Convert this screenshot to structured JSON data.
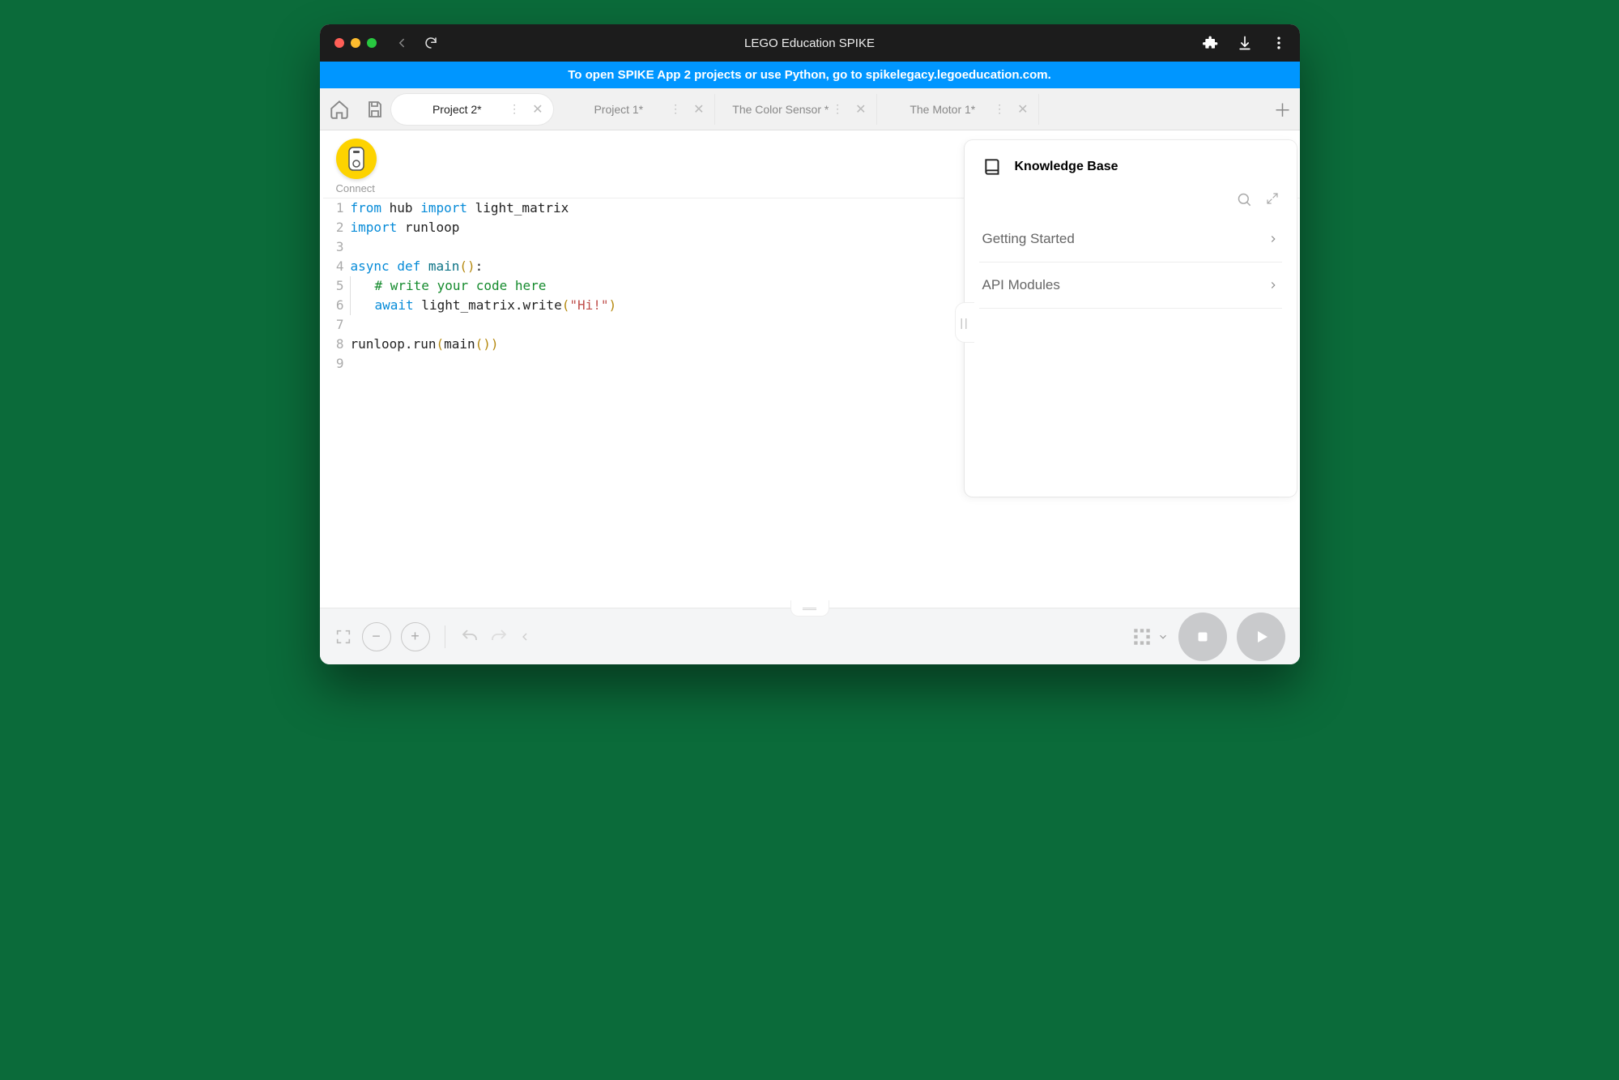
{
  "window": {
    "title": "LEGO Education SPIKE"
  },
  "banner": {
    "text": "To open SPIKE App 2 projects or use Python, go to spikelegacy.legoeducation.com."
  },
  "tabs": [
    {
      "label": "Project 2*",
      "active": true
    },
    {
      "label": "Project 1*",
      "active": false
    },
    {
      "label": "The Color Sensor *",
      "active": false
    },
    {
      "label": "The Motor 1*",
      "active": false
    }
  ],
  "connect": {
    "label": "Connect"
  },
  "code": {
    "lines": [
      {
        "n": 1,
        "html": "<span class='kw'>from</span> hub <span class='kw'>import</span> light_matrix"
      },
      {
        "n": 2,
        "html": "<span class='kw'>import</span> runloop"
      },
      {
        "n": 3,
        "html": ""
      },
      {
        "n": 4,
        "html": "<span class='kw'>async</span> <span class='kw'>def</span> <span style='color:#0b7285'>main</span><span class='pun'>()</span>:"
      },
      {
        "n": 5,
        "html": "<span class='indent-guide'><span class='cmt'># write your code here</span></span>"
      },
      {
        "n": 6,
        "html": "<span class='indent-guide'><span class='kw'>await</span> light_matrix.write<span class='pun'>(</span><span class='str'>\"Hi!\"</span><span class='pun'>)</span></span>"
      },
      {
        "n": 7,
        "html": ""
      },
      {
        "n": 8,
        "html": "runloop.run<span class='pun'>(</span>main<span class='pun'>())</span>"
      },
      {
        "n": 9,
        "html": ""
      }
    ]
  },
  "kb": {
    "title": "Knowledge Base",
    "items": [
      {
        "label": "Getting Started"
      },
      {
        "label": "API Modules"
      }
    ]
  }
}
